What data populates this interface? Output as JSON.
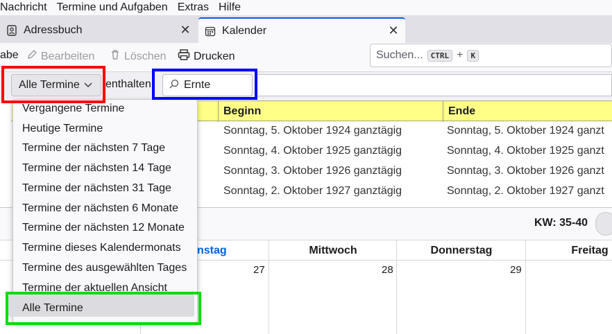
{
  "menubar": [
    "Nachricht",
    "Termine und Aufgaben",
    "Extras",
    "Hilfe"
  ],
  "tabs": [
    {
      "label": "Adressbuch",
      "icon": "address-book-icon"
    },
    {
      "label": "Kalender",
      "icon": "calendar-icon"
    }
  ],
  "toolbar": {
    "partial_label": "abe",
    "edit_label": "Bearbeiten",
    "delete_label": "Löschen",
    "print_label": "Drucken",
    "search_placeholder": "Suchen...",
    "shortcut_ctrl": "CTRL",
    "shortcut_plus": "+",
    "shortcut_key": "K"
  },
  "filter": {
    "selected": "Alle Termine",
    "contains_label": "enthalten",
    "search_value": "Ernte"
  },
  "list": {
    "columns": [
      "Beginn",
      "Ende"
    ],
    "rows": [
      {
        "start": "Sonntag, 5. Oktober 1924 ganztägig",
        "end": "Sonntag, 5. Oktober 1924 ganzt"
      },
      {
        "start": "Sonntag, 4. Oktober 1925 ganztägig",
        "end": "Sonntag, 4. Oktober 1925 ganzt"
      },
      {
        "start": "Sonntag, 3. Oktober 1926 ganztägig",
        "end": "Sonntag, 3. Oktober 1926 ganzt"
      },
      {
        "start": "Sonntag, 2. Oktober 1927 ganztägig",
        "end": "Sonntag, 2. Oktober 1927 ganzt"
      }
    ]
  },
  "week": {
    "kw_label": "KW: 35-40",
    "days": [
      "nstag",
      "Mittwoch",
      "Donnerstag",
      "Freitag"
    ],
    "numbers": [
      "27",
      "28",
      "29"
    ]
  },
  "dropdown_options": [
    "Vergangene Termine",
    "Heutige Termine",
    "Termine der nächsten 7 Tage",
    "Termine der nächsten 14 Tage",
    "Termine der nächsten 31 Tage",
    "Termine der nächsten 6 Monate",
    "Termine der nächsten 12 Monate",
    "Termine dieses Kalendermonats",
    "Termine des ausgewählten Tages",
    "Termine der aktuellen Ansicht",
    "Alle Termine"
  ],
  "highlight_colors": {
    "select": "#ff0000",
    "search": "#0000ff",
    "option": "#00dd00"
  },
  "accent": "#0060df"
}
